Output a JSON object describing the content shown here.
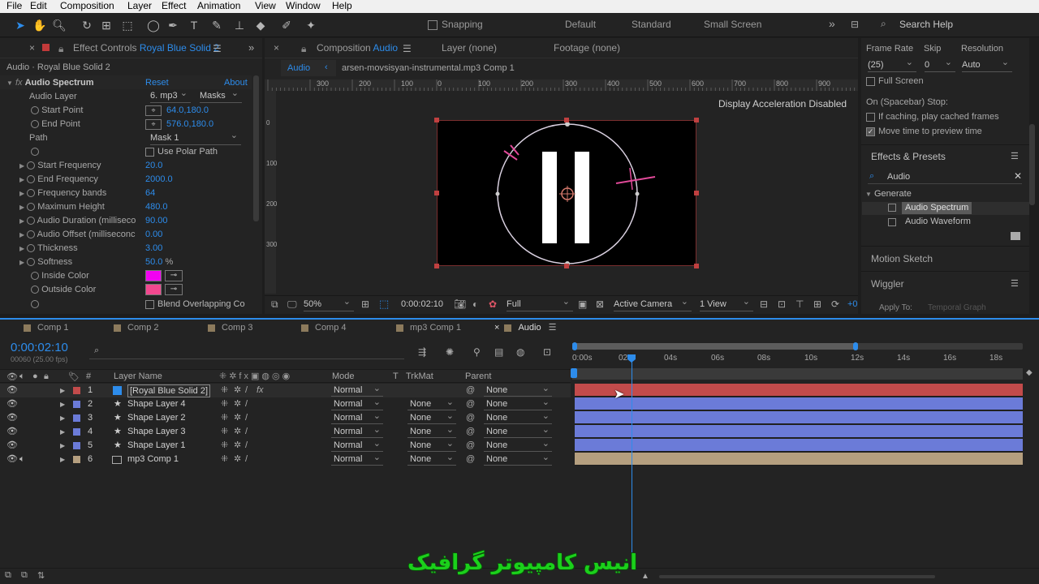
{
  "menu": [
    "File",
    "Edit",
    "Composition",
    "Layer",
    "Effect",
    "Animation",
    "View",
    "Window",
    "Help"
  ],
  "toolbar": {
    "snapping": "Snapping",
    "workspaces": [
      "Default",
      "Standard",
      "Small Screen"
    ],
    "search_placeholder": "Search Help"
  },
  "effect_controls": {
    "close": "×",
    "title": "Effect Controls",
    "layer": "Royal Blue Solid 2",
    "path": "Audio · Royal Blue Solid 2",
    "effect_name": "Audio Spectrum",
    "reset": "Reset",
    "about": "About",
    "rows": [
      {
        "label": "Audio Layer",
        "value": "6. mp3",
        "value2": "Masks"
      },
      {
        "label": "Start Point",
        "value": "64.0,180.0"
      },
      {
        "label": "End Point",
        "value": "576.0,180.0"
      },
      {
        "label": "Path",
        "value": "Mask 1"
      },
      {
        "label": "Use Polar Path"
      },
      {
        "label": "Start Frequency",
        "value": "20.0"
      },
      {
        "label": "End Frequency",
        "value": "2000.0"
      },
      {
        "label": "Frequency bands",
        "value": "64"
      },
      {
        "label": "Maximum Height",
        "value": "480.0"
      },
      {
        "label": "Audio Duration (milliseco",
        "value": "90.00"
      },
      {
        "label": "Audio Offset (milliseconc",
        "value": "0.00"
      },
      {
        "label": "Thickness",
        "value": "3.00"
      },
      {
        "label": "Softness",
        "value": "50.0",
        "unit": "%"
      },
      {
        "label": "Inside Color",
        "color": "#f200f2"
      },
      {
        "label": "Outside Color",
        "color": "#f2488f"
      },
      {
        "label": "Blend Overlapping Co"
      }
    ]
  },
  "comp_panel": {
    "close": "×",
    "title": "Composition",
    "comp": "Audio",
    "layer_tab": "Layer (none)",
    "footage_tab": "Footage (none)",
    "breadcrumb_comp": "Audio",
    "breadcrumb_next": "arsen-movsisyan-instrumental.mp3 Comp 1",
    "ruler": [
      "300",
      "200",
      "100",
      "0",
      "100",
      "200",
      "300",
      "400",
      "500",
      "600",
      "700",
      "800",
      "900"
    ],
    "vruler": [
      "0",
      "100",
      "200",
      "300"
    ],
    "accel": "Display Acceleration Disabled",
    "zoom": "50%",
    "time": "0:00:02:10",
    "res": "Full",
    "camera": "Active Camera",
    "view": "1 View",
    "exposure": "+0"
  },
  "preview": {
    "frame_rate": "Frame Rate",
    "skip": "Skip",
    "resolution": "Resolution",
    "fr_val": "(25)",
    "skip_val": "0",
    "res_val": "Auto",
    "full_screen": "Full Screen",
    "on_stop": "On (Spacebar) Stop:",
    "if_caching": "If caching, play cached frames",
    "move_time": "Move time to preview time"
  },
  "effects_presets": {
    "title": "Effects & Presets",
    "search": "Audio",
    "group": "Generate",
    "items": [
      "Audio Spectrum",
      "Audio Waveform"
    ]
  },
  "motion_sketch": "Motion Sketch",
  "wiggler": {
    "title": "Wiggler",
    "apply_to": "Apply To:",
    "apply_val": "Temporal Graph"
  },
  "timeline": {
    "tabs": [
      "Comp 1",
      "Comp 2",
      "Comp 3",
      "Comp 4",
      "mp3 Comp 1",
      "Audio"
    ],
    "tab_colors": [
      "#8c7a5c",
      "#8c7a5c",
      "#8c7a5c",
      "#8c7a5c",
      "#8c7a5c",
      "#8c7a5c"
    ],
    "timecode": "0:00:02:10",
    "frames": "00060 (25.00 fps)",
    "headers": {
      "layer_name": "Layer Name",
      "mode": "Mode",
      "t": "T",
      "trkmat": "TrkMat",
      "parent": "Parent"
    },
    "ticks": [
      "0:00s",
      "02s",
      "04s",
      "06s",
      "08s",
      "10s",
      "12s",
      "14s",
      "16s",
      "18s"
    ],
    "layers": [
      {
        "num": "1",
        "name": "[Royal Blue Solid 2]",
        "mode": "Normal",
        "trkmat": "",
        "parent": "None",
        "color": "#c24b4b",
        "icon": "#2d8ceb"
      },
      {
        "num": "2",
        "name": "Shape Layer 4",
        "mode": "Normal",
        "trkmat": "None",
        "parent": "None",
        "color": "#6b7bd8",
        "icon": "star"
      },
      {
        "num": "3",
        "name": "Shape Layer 2",
        "mode": "Normal",
        "trkmat": "None",
        "parent": "None",
        "color": "#6b7bd8",
        "icon": "star"
      },
      {
        "num": "4",
        "name": "Shape Layer 3",
        "mode": "Normal",
        "trkmat": "None",
        "parent": "None",
        "color": "#6b7bd8",
        "icon": "star"
      },
      {
        "num": "5",
        "name": "Shape Layer 1",
        "mode": "Normal",
        "trkmat": "None",
        "parent": "None",
        "color": "#6b7bd8",
        "icon": "star"
      },
      {
        "num": "6",
        "name": "mp3 Comp 1",
        "mode": "Normal",
        "trkmat": "None",
        "parent": "None",
        "color": "#b59f7f",
        "icon": "comp"
      }
    ]
  },
  "watermark": "انیس کامپیوتر گرافیک"
}
